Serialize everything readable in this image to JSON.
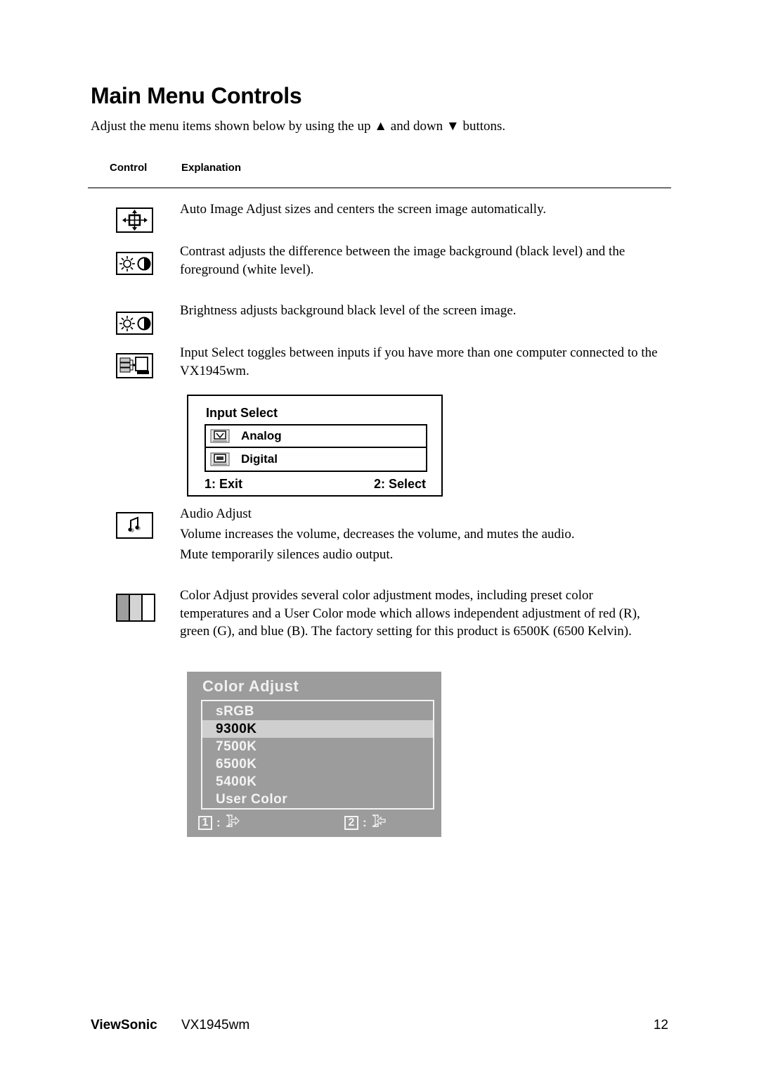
{
  "page": {
    "title": "Main Menu Controls",
    "intro_before_up": "Adjust the menu items shown below by using the up ",
    "up_glyph": "▲",
    "intro_between": " and down ",
    "down_glyph": "▼",
    "intro_after": " buttons."
  },
  "table": {
    "headers": {
      "control": "Control",
      "explanation": "Explanation"
    },
    "rows": [
      {
        "icon": "auto-image-adjust-icon",
        "text": "Auto Image Adjust sizes and centers the screen image automatically."
      },
      {
        "icon": "contrast-icon",
        "text": "Contrast adjusts the difference between the image background  (black level) and the foreground (white level)."
      },
      {
        "icon": "brightness-icon",
        "text": "Brightness adjusts background black level of the screen image."
      },
      {
        "icon": "input-select-icon",
        "text": "Input Select toggles between inputs if you have more than one computer connected to the VX1945wm."
      },
      {
        "icon": "audio-adjust-icon",
        "title": "Audio Adjust",
        "line1": "Volume increases the volume, decreases the volume, and mutes the audio.",
        "line2": "Mute temporarily silences audio output."
      },
      {
        "icon": "color-adjust-icon",
        "text": "Color Adjust provides several color adjustment modes, including preset color temperatures and a User Color mode which allows independent adjustment of red (R), green (G), and blue (B). The factory setting for this product is 6500K (6500 Kelvin)."
      }
    ]
  },
  "osd_input_select": {
    "title": "Input Select",
    "items": [
      {
        "label": "Analog",
        "icon": "analog-monitor-icon"
      },
      {
        "label": "Digital",
        "icon": "digital-monitor-icon"
      }
    ],
    "footer_left": "1: Exit",
    "footer_right": "2: Select"
  },
  "osd_color_adjust": {
    "title": "Color Adjust",
    "items": [
      "sRGB",
      "9300K",
      "7500K",
      "6500K",
      "5400K",
      "User Color"
    ],
    "selected": "9300K",
    "colors": {
      "panel": "#9c9c9c",
      "highlight": "#cfcfcf",
      "text": "#f4f4f4"
    },
    "footer": [
      {
        "key": "1",
        "sep": ":",
        "icon": "exit-door-icon"
      },
      {
        "key": "2",
        "sep": ":",
        "icon": "enter-door-icon"
      }
    ]
  },
  "footer": {
    "brand": "ViewSonic",
    "model": "VX1945wm",
    "page_number": "12"
  }
}
